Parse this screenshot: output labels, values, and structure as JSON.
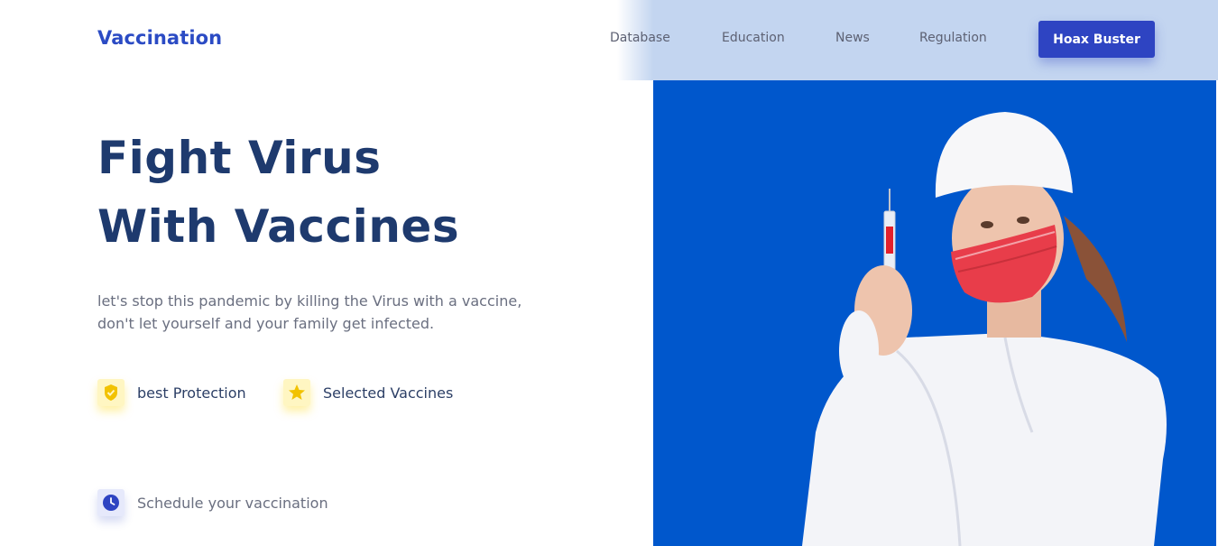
{
  "header": {
    "logo": "Vaccination",
    "nav": [
      "Database",
      "Education",
      "News",
      "Regulation"
    ],
    "cta_label": "Hoax Buster"
  },
  "hero": {
    "headline_line1": "Fight Virus",
    "headline_line2": "With Vaccines",
    "description_line1": "let's stop this pandemic by killing the Virus with a vaccine,",
    "description_line2": "don't let yourself and your family get infected.",
    "features": [
      {
        "label": "best Protection",
        "icon": "shield-icon"
      },
      {
        "label": "Selected Vaccines",
        "icon": "star-icon"
      }
    ],
    "schedule_label": "Schedule your vaccination",
    "schedule_icon": "clock-icon"
  },
  "colors": {
    "brand": "#2b4bc4",
    "headline": "#1e3a6e",
    "photo_bg": "#0057cc",
    "feature_accent": "#ffd400"
  }
}
